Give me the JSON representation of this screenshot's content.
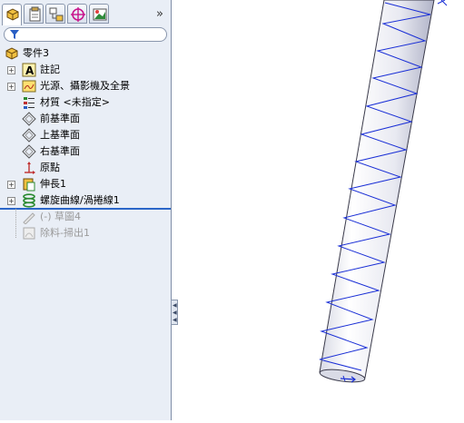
{
  "tabs": {
    "items": [
      {
        "name": "featuremanager-tab-icon"
      },
      {
        "name": "propertymanager-tab-icon"
      },
      {
        "name": "configurationmanager-tab-icon"
      },
      {
        "name": "dimxpert-tab-icon"
      },
      {
        "name": "display-manager-tab-icon"
      }
    ],
    "more_label": "»"
  },
  "tree": {
    "root": "零件3",
    "items": [
      {
        "label": "註記",
        "expandable": true,
        "icon": "annotation-icon"
      },
      {
        "label": "光源、攝影機及全景",
        "expandable": true,
        "icon": "lights-cameras-icon"
      },
      {
        "label": "材質 <未指定>",
        "expandable": false,
        "icon": "material-icon"
      },
      {
        "label": "前基準面",
        "expandable": false,
        "icon": "plane-icon"
      },
      {
        "label": "上基準面",
        "expandable": false,
        "icon": "plane-icon"
      },
      {
        "label": "右基準面",
        "expandable": false,
        "icon": "plane-icon"
      },
      {
        "label": "原點",
        "expandable": false,
        "icon": "origin-icon"
      },
      {
        "label": "伸長1",
        "expandable": true,
        "icon": "extrude-icon"
      },
      {
        "label": "螺旋曲線/渦捲線1",
        "expandable": true,
        "icon": "helix-icon"
      },
      {
        "label": "(-) 草圖4",
        "expandable": false,
        "icon": "sketch-icon",
        "suppressed": true
      },
      {
        "label": "除料-掃出1",
        "expandable": false,
        "icon": "sweep-cut-icon",
        "suppressed": true
      }
    ],
    "expand_symbol": "+"
  },
  "colors": {
    "panel_bg": "#e9eef6",
    "rollback_bar": "#2b66c8",
    "helix_curve": "#1a2fd6",
    "cylinder_edge": "#3a3a4a"
  }
}
